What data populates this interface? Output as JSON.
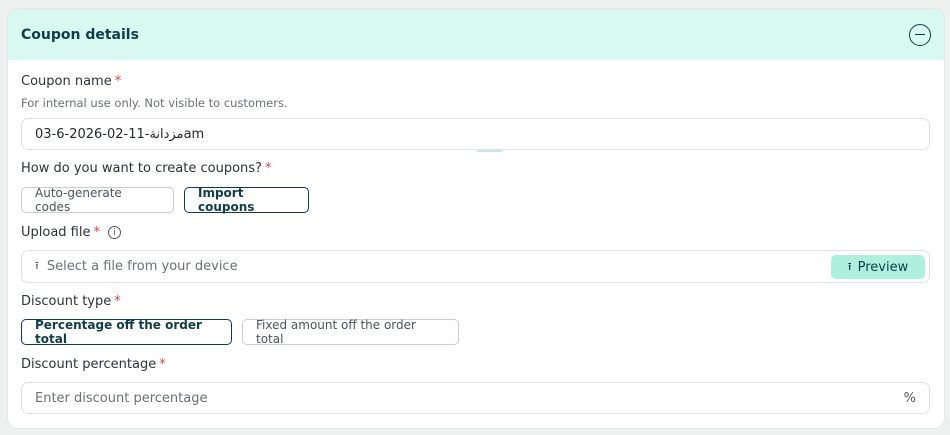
{
  "header": {
    "title": "Coupon details"
  },
  "coupon_name": {
    "label": "Coupon name",
    "required_mark": "*",
    "hint": "For internal use only. Not visible to customers.",
    "value": "03-6-2026-02-11-مزدانةam"
  },
  "create_method": {
    "label": "How do you want to create coupons?",
    "required_mark": "*",
    "options": [
      "Auto-generate codes",
      "Import coupons"
    ],
    "selected": "Import coupons"
  },
  "upload": {
    "label": "Upload file",
    "required_mark": "*",
    "placeholder": "Select a file from your device",
    "preview_label": "Preview"
  },
  "discount_type": {
    "label": "Discount type",
    "required_mark": "*",
    "options": [
      "Percentage off the order total",
      "Fixed amount off the order total"
    ],
    "selected": "Percentage off the order total"
  },
  "discount_percentage": {
    "label": "Discount percentage",
    "required_mark": "*",
    "placeholder": "Enter discount percentage",
    "suffix": "%"
  },
  "colors": {
    "header_bg": "#d9f8f0",
    "accent": "#0e3d4a",
    "preview_bg": "#aef0dd",
    "required": "#e0453a"
  }
}
